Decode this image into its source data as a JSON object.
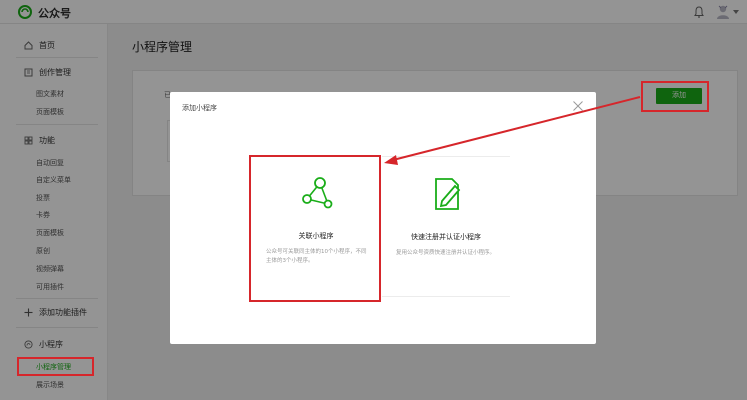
{
  "topbar": {
    "brand": "公众号",
    "logo_icon": "wechat-mp-logo-icon",
    "bell_icon": "bell-icon",
    "avatar_icon": "user-avatar-icon"
  },
  "sidebar": {
    "home": "首页",
    "sections": [
      {
        "title": "创作管理",
        "items": [
          "图文素材",
          "页面模板"
        ]
      },
      {
        "title": "功能",
        "items": [
          "自动回复",
          "自定义菜单",
          "投票",
          "卡券",
          "页面模板",
          "原创",
          "视频弹幕",
          "可用插件"
        ]
      },
      {
        "title": "添加功能插件",
        "items": []
      },
      {
        "title": "小程序",
        "items": [
          "小程序管理",
          "展示场景"
        ]
      }
    ],
    "active_item": "小程序管理"
  },
  "main": {
    "page_title": "小程序管理",
    "card_label": "已",
    "add_button": "添加"
  },
  "modal": {
    "title": "添加小程序",
    "options": [
      {
        "title": "关联小程序",
        "desc": "公众号可关联同主体的10个小程序，不同主体的3个小程序。"
      },
      {
        "title": "快速注册并认证小程序",
        "desc": "复用公众号资质快速注册并认证小程序。"
      }
    ]
  },
  "colors": {
    "accent_green": "#1aad19",
    "annotation_red": "#d6262b"
  }
}
